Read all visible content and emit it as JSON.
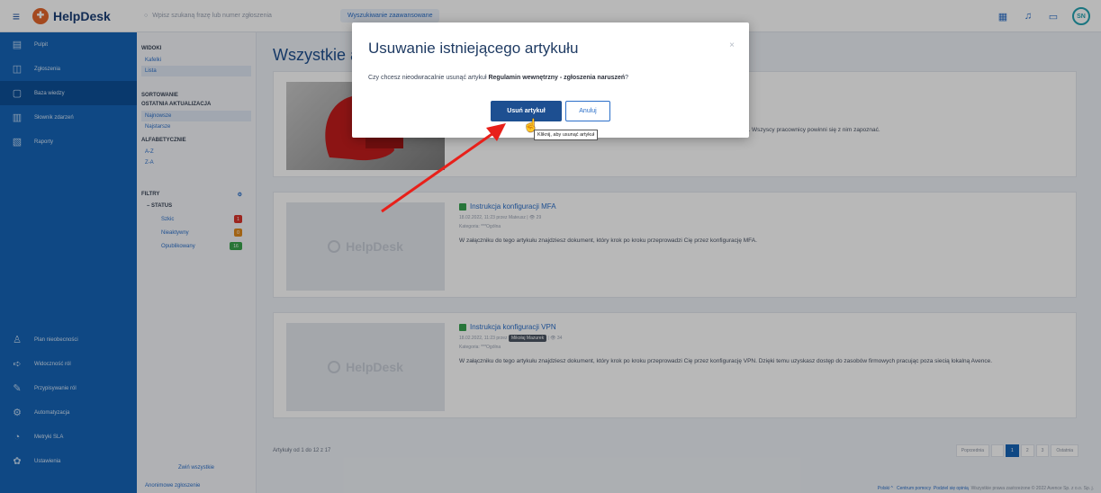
{
  "topbar": {
    "logo_text": "HelpDesk",
    "search_placeholder": "Wpisz szukaną frazę lub numer zgłoszenia",
    "advanced_search": "Wyszukiwanie zaawansowane",
    "avatar_initials": "SN"
  },
  "sidebar": {
    "items": [
      {
        "label": "Pulpit",
        "icon": "dashboard-icon"
      },
      {
        "label": "Zgłoszenia",
        "icon": "tickets-icon"
      },
      {
        "label": "Baza wiedzy",
        "icon": "knowledge-base-icon"
      },
      {
        "label": "Słownik zdarzeń",
        "icon": "dictionary-icon"
      },
      {
        "label": "Raporty",
        "icon": "reports-icon"
      }
    ],
    "bottom_items": [
      {
        "label": "Plan nieobecności",
        "icon": "people-icon"
      },
      {
        "label": "Widoczność ról",
        "icon": "visibility-icon"
      },
      {
        "label": "Przypisywanie ról",
        "icon": "assign-icon"
      },
      {
        "label": "Automatyzacja",
        "icon": "automation-icon"
      },
      {
        "label": "Metryki SLA",
        "icon": "metrics-icon"
      },
      {
        "label": "Ustawienia",
        "icon": "settings-icon"
      }
    ]
  },
  "filters": {
    "views_header": "WIDOKI",
    "views": [
      "Kafelki",
      "Lista"
    ],
    "sort_header": "SORTOWANIE",
    "sort_sub": "OSTATNIA AKTUALIZACJA",
    "sort_options": [
      "Najnowsze",
      "Najstarsze"
    ],
    "alpha_header": "ALFABETYCZNIE",
    "alpha_options": [
      "A-Z",
      "Z-A"
    ],
    "filters_header": "FILTRY",
    "status_header": "STATUS",
    "statuses": [
      {
        "label": "Szkic",
        "count": "1",
        "color": "#d9342b"
      },
      {
        "label": "Nieaktywny",
        "count": "0",
        "color": "#e08a1e"
      },
      {
        "label": "Opublikowany",
        "count": "16",
        "color": "#3aa34b"
      }
    ],
    "collapse_all": "Zwiń wszystkie",
    "anonymous": "Anonimowe zgłoszenie"
  },
  "main": {
    "title": "Wszystkie artykuły",
    "cards": [
      {
        "title": "",
        "meta": "",
        "category": "",
        "text": "pracy. Wszyscy pracownicy powinni się z nim zapoznać."
      },
      {
        "title": "Instrukcja konfiguracji MFA",
        "meta": "18.02.2022, 11:23 przez Mateusz | 👁 29",
        "category": "Kategoria: ***Ogólna",
        "text": "W załączniku do tego artykułu znajdziesz dokument, który krok po kroku przeprowadzi Cię przez konfigurację MFA.",
        "thumb_text": "HelpDesk"
      },
      {
        "title": "Instrukcja konfiguracji VPN",
        "meta_prefix": "18.02.2022, 11:23 przez",
        "meta_author": "Mikołaj Mazurek",
        "meta_views": "👁 34",
        "category": "Kategoria: ***Ogólna",
        "text": "W załączniku do tego artykułu znajdziesz dokument, który krok po kroku przeprowadzi Cię przez konfigurację VPN. Dzięki temu uzyskasz dostęp do zasobów firmowych pracując poza siecią lokalną Avence.",
        "thumb_text": "HelpDesk"
      }
    ],
    "pager_info": "Artykuły od 1 do 12 z 17",
    "pager": [
      "Poprzednia",
      "1",
      "2",
      "3",
      "Ostatnia"
    ]
  },
  "footer": {
    "lang": "Polski ^",
    "help": "Centrum pomocy",
    "feedback": "Podziel się opinią",
    "copyright": "Wszystkie prawa zastrzeżone © 2022 Avence Sp. z o.o. Sp. j."
  },
  "modal": {
    "title": "Usuwanie istniejącego artykułu",
    "close": "×",
    "body_prefix": "Czy chcesz nieodwracalnie usunąć artykuł",
    "article_name": "Regulamin wewnętrzny - zgłoszenia naruszeń",
    "body_suffix": "?",
    "delete_button": "Usuń artykuł",
    "cancel_button": "Anuluj",
    "tooltip": "Kliknij, aby usunąć artykuł"
  }
}
